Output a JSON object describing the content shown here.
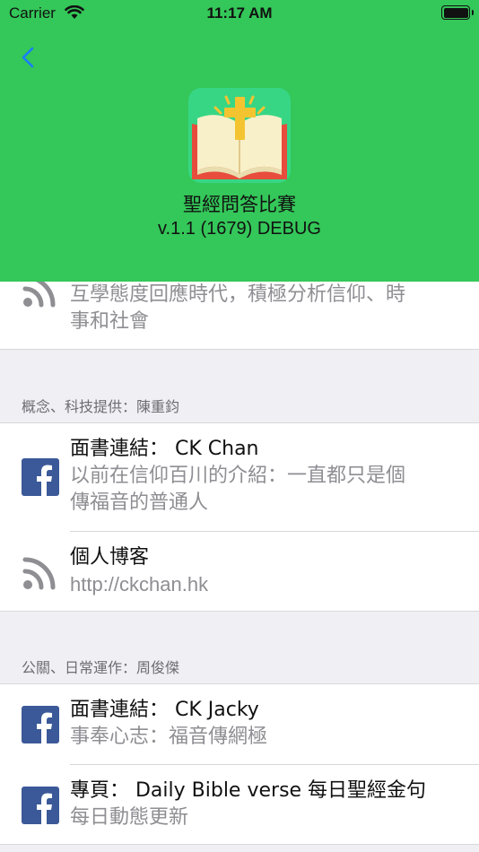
{
  "status_bar": {
    "carrier": "Carrier",
    "time": "11:17 AM"
  },
  "header": {
    "app_name": "聖經問答比賽",
    "version": "v.1.1 (1679) DEBUG"
  },
  "top_cell": {
    "subtitle_line1": "互學態度回應時代，積極分析信仰、時",
    "subtitle_line2": "事和社會"
  },
  "sections": [
    {
      "header": "概念、科技提供：陳重鈞",
      "items": [
        {
          "icon": "facebook-icon",
          "title": "面書連結： CK Chan",
          "subtitle_line1": "以前在信仰百川的介紹：一直都只是個",
          "subtitle_line2": "傳福音的普通人"
        },
        {
          "icon": "rss-icon",
          "title": "個人博客",
          "subtitle_line1": "http://ckchan.hk"
        }
      ]
    },
    {
      "header": "公關、日常運作：周俊傑",
      "items": [
        {
          "icon": "facebook-icon",
          "title": "面書連結： CK Jacky",
          "subtitle_line1": "事奉心志：福音傳網極"
        },
        {
          "icon": "facebook-icon",
          "title": "專頁： Daily Bible verse 每日聖經金句",
          "subtitle_line1": "每日動態更新"
        }
      ]
    }
  ],
  "colors": {
    "header_bg": "#34c759",
    "back_tint": "#1a7cff",
    "facebook": "#3b5998"
  }
}
